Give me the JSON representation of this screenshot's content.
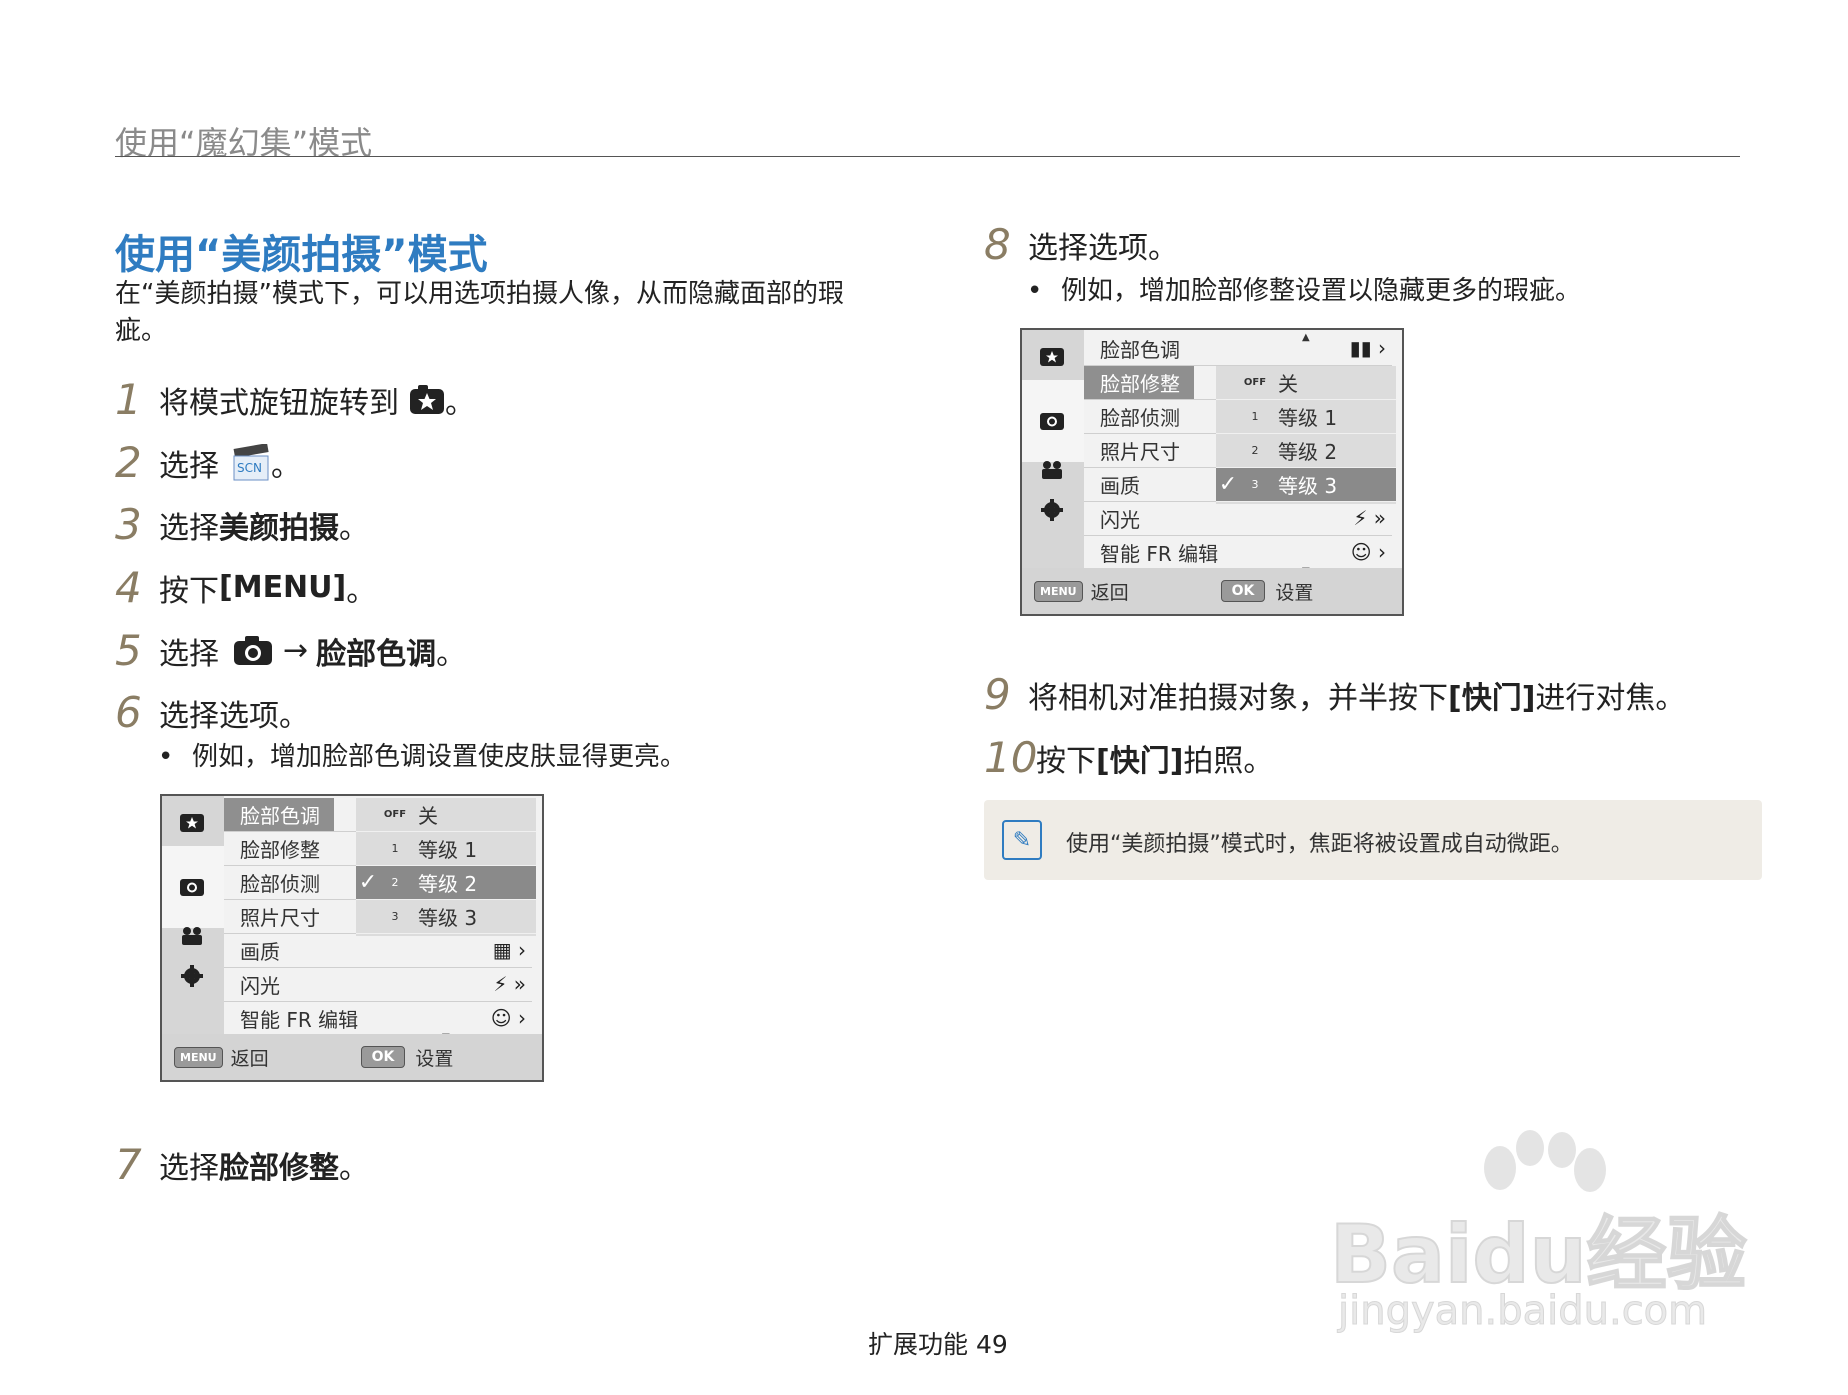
{
  "header": {
    "title": "使用“魔幻集”模式"
  },
  "section": {
    "title": "使用“美颜拍摄”模式",
    "intro": "在“美颜拍摄”模式下，可以用选项拍摄人像，从而隐藏面部的瑕疵。"
  },
  "steps": [
    {
      "num": "1",
      "pre": "将模式旋钮旋转到",
      "post": "。"
    },
    {
      "num": "2",
      "pre": "选择",
      "post": "。",
      "scn": "SCN"
    },
    {
      "num": "3",
      "pre": "选择",
      "bold": "美颜拍摄",
      "post": "。"
    },
    {
      "num": "4",
      "pre": "按下 ",
      "bold": "[MENU]",
      "post": "。"
    },
    {
      "num": "5",
      "pre": "选择",
      "arrow": "→",
      "bold": "脸部色调",
      "post": "。"
    },
    {
      "num": "6",
      "text": "选择选项。",
      "bullet": "例如，增加脸部色调设置使皮肤显得更亮。"
    },
    {
      "num": "7",
      "pre": "选择",
      "bold": "脸部修整",
      "post": "。"
    },
    {
      "num": "8",
      "text": "选择选项。",
      "bullet": "例如，增加脸部修整设置以隐藏更多的瑕疵。"
    },
    {
      "num": "9",
      "pre": "将相机对准拍摄对象，并半按下 ",
      "bold": "[快门]",
      "post": " 进行对焦。"
    },
    {
      "num": "10",
      "pre": "按下 ",
      "bold": "[快门]",
      "post": " 拍照。"
    }
  ],
  "menu1": {
    "items": [
      "脸部色调",
      "脸部修整",
      "脸部侦测",
      "照片尺寸",
      "画质",
      "闪光",
      "智能 FR 编辑"
    ],
    "options": [
      {
        "icon": "OFF",
        "label": "关"
      },
      {
        "icon": "1",
        "label": "等级 1"
      },
      {
        "icon": "2",
        "label": "等级 2",
        "check": "✓"
      },
      {
        "icon": "3",
        "label": "等级 3"
      }
    ],
    "back": "返回",
    "set": "设置",
    "menu_btn": "MENU",
    "ok_btn": "OK"
  },
  "menu2": {
    "items": [
      "脸部色调",
      "脸部修整",
      "脸部侦测",
      "照片尺寸",
      "画质",
      "闪光",
      "智能 FR 编辑"
    ],
    "options": [
      {
        "icon": "OFF",
        "label": "关"
      },
      {
        "icon": "1",
        "label": "等级 1"
      },
      {
        "icon": "2",
        "label": "等级 2"
      },
      {
        "icon": "3",
        "label": "等级 3",
        "check": "✓"
      }
    ],
    "back": "返回",
    "set": "设置",
    "menu_btn": "MENU",
    "ok_btn": "OK"
  },
  "note": {
    "text": "使用“美颜拍摄”模式时，焦距将被设置成自动微距。"
  },
  "footer": {
    "text": "扩展功能  49"
  },
  "watermark": {
    "brand": "Baidu经验",
    "url": "jingyan.baidu.com"
  },
  "colors": {
    "title_blue": "#2f7cc1",
    "step_num": "#8a7d64",
    "note_bg": "#efece6"
  }
}
